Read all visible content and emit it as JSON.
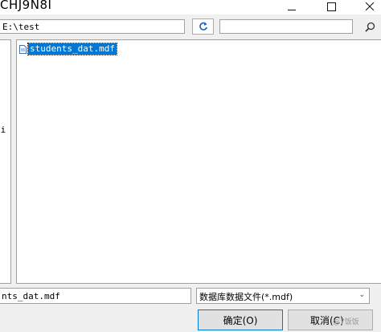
{
  "window": {
    "title": "CHJ9N8I"
  },
  "address_bar": {
    "path": "E:\\test",
    "search_value": ""
  },
  "tree": {
    "visible_label": "ti"
  },
  "file_list": {
    "items": [
      {
        "name": "students_dat.mdf",
        "selected": true
      }
    ]
  },
  "bottom": {
    "filename_value": "nts_dat.mdf",
    "filetype_selected": "数据库数据文件(*.mdf)",
    "ok_label": "确定(O)",
    "cancel_label": "取消(C)"
  },
  "watermark": {
    "text": "@7饭饭"
  },
  "colors": {
    "selection": "#0078d7",
    "window_bg": "#f0f0f0",
    "border": "#a0a0a0"
  }
}
